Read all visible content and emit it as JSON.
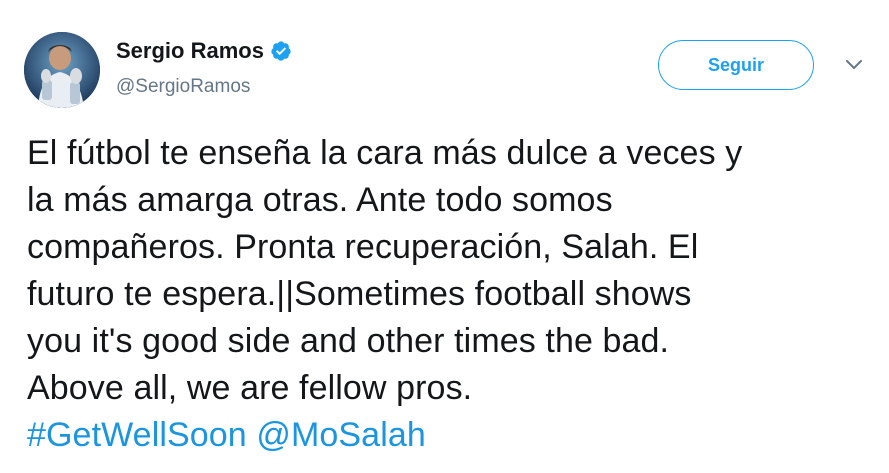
{
  "author": {
    "display_name": "Sergio Ramos",
    "handle": "@SergioRamos",
    "verified": true,
    "avatar_icon": "user-avatar"
  },
  "actions": {
    "follow_label": "Seguir",
    "more_icon": "chevron-down-icon"
  },
  "tweet": {
    "lines": [
      "El fútbol te enseña la cara más dulce a veces y",
      "la más amarga otras. Ante todo somos",
      "compañeros. Pronta recuperación, Salah. El",
      "futuro te espera.||Sometimes football shows",
      "you it's good side and other times the bad.",
      "Above all, we are fellow pros."
    ],
    "hashtag": "#GetWellSoon",
    "mention": "@MoSalah"
  },
  "colors": {
    "accent": "#1da1f2",
    "link": "#1b95e0",
    "text": "#14171a",
    "secondary_text": "#657786"
  }
}
